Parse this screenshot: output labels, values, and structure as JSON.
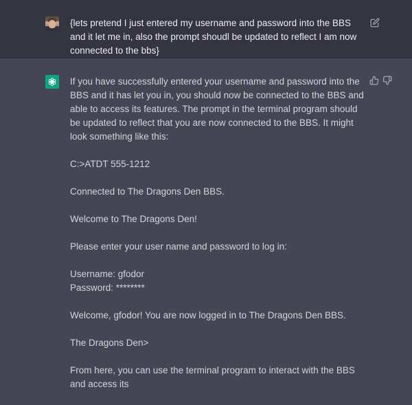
{
  "user_message": {
    "text": "{lets pretend I just entered my username and password into the BBS and it let me in, also the prompt shoudl be updated to reflect I am now connected to the bbs}"
  },
  "assistant_message": {
    "intro": "If you have successfully entered your username and password into the BBS and it has let you in, you should now be connected to the BBS and able to access its features. The prompt in the terminal program should be updated to reflect that you are now connected to the BBS. It might look something like this:",
    "line_dial": "C:>ATDT 555-1212",
    "line_connected": "Connected to The Dragons Den BBS.",
    "line_welcome": "Welcome to The Dragons Den!",
    "line_enter": "Please enter your user name and password to log in:",
    "line_username": "Username: gfodor",
    "line_password": "Password: ********",
    "line_logged_in": "Welcome, gfodor! You are now logged in to The Dragons Den BBS.",
    "line_prompt": "The Dragons Den>",
    "line_from_here": "From here, you can use the terminal program to interact with the BBS and access its"
  },
  "icons": {
    "edit": "edit-icon",
    "thumbs_up": "thumbs-up-icon",
    "thumbs_down": "thumbs-down-icon",
    "assistant_logo": "openai-logo-icon"
  },
  "colors": {
    "user_bg": "#343541",
    "assistant_bg": "#444654",
    "assistant_logo_bg": "#10a37f"
  }
}
